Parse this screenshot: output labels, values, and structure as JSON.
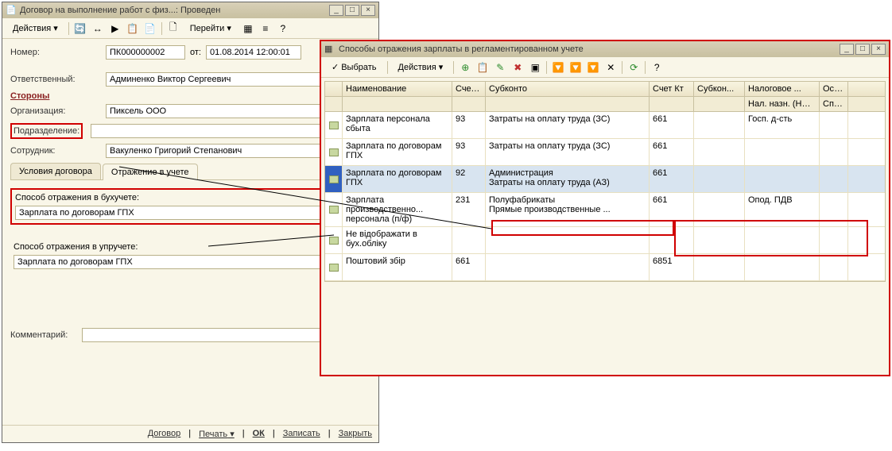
{
  "win1": {
    "title": "Договор на выполнение работ с физ...: Проведен",
    "toolbar": {
      "actions": "Действия",
      "goto": "Перейти"
    },
    "labels": {
      "number": "Номер:",
      "ot": "от:",
      "responsible": "Ответственный:",
      "parties": "Стороны",
      "org": "Организация:",
      "division": "Подразделение:",
      "employee": "Сотрудник:",
      "comment": "Комментарий:"
    },
    "values": {
      "number": "ПК000000002",
      "date": "01.08.2014 12:00:01",
      "responsible": "Админенко Виктор Сергеевич",
      "org": "Пиксель ООО",
      "division": "",
      "employee": "Вакуленко Григорий Степанович",
      "comment": ""
    },
    "tabs": {
      "t1": "Условия договора",
      "t2": "Отражение в учете"
    },
    "panel": {
      "bu_label": "Способ отражения в бухучете:",
      "bu_value": "Зарплата по договорам ГПХ",
      "upr_label": "Способ отражения в упручете:",
      "upr_value": "Зарплата по договорам ГПХ"
    },
    "footer": {
      "dog": "Договор",
      "print": "Печать",
      "ok": "ОК",
      "save": "Записать",
      "close": "Закрыть"
    }
  },
  "win2": {
    "title": "Способы отражения зарплаты в регламентированном учете",
    "toolbar": {
      "select": "Выбрать",
      "actions": "Действия"
    },
    "headers": {
      "name": "Наименование",
      "sdt": "Счет Дт",
      "sub": "Субконто",
      "skt": "Счет Кт",
      "sub2": "Субкон...",
      "nal": "Налоговое ...",
      "oso": "Осо..."
    },
    "subheaders": {
      "nal": "Нал. назн. (НДС)",
      "oso": "Спо... отр..."
    },
    "rows": [
      {
        "name": "Зарплата персонала сбыта",
        "sdt": "93",
        "sub": [
          "Затраты на оплату труда (ЗС)"
        ],
        "skt": "661",
        "nal": "Госп. д-сть"
      },
      {
        "name": "Зарплата по договорам ГПХ",
        "sdt": "93",
        "sub": [
          "Затраты на оплату труда (ЗС)"
        ],
        "skt": "661"
      },
      {
        "selected": true,
        "name": "Зарплата по договорам ГПХ",
        "sdt": "92",
        "sub": [
          "Администрация",
          "Затраты на оплату труда (АЗ)"
        ],
        "skt": "661"
      },
      {
        "name": "Зарплата производственно... персонала (п/ф)",
        "sdt": "231",
        "sub": [
          "",
          "Полуфабрикаты",
          "Прямые производственные ..."
        ],
        "skt": "661",
        "nal": "Опод. ПДВ"
      },
      {
        "name": "Не відображати в бух.обліку",
        "sdt": "",
        "sub": [],
        "skt": ""
      },
      {
        "name": "Поштовий збір",
        "sdt": "661",
        "sub": [],
        "skt": "6851"
      }
    ]
  }
}
